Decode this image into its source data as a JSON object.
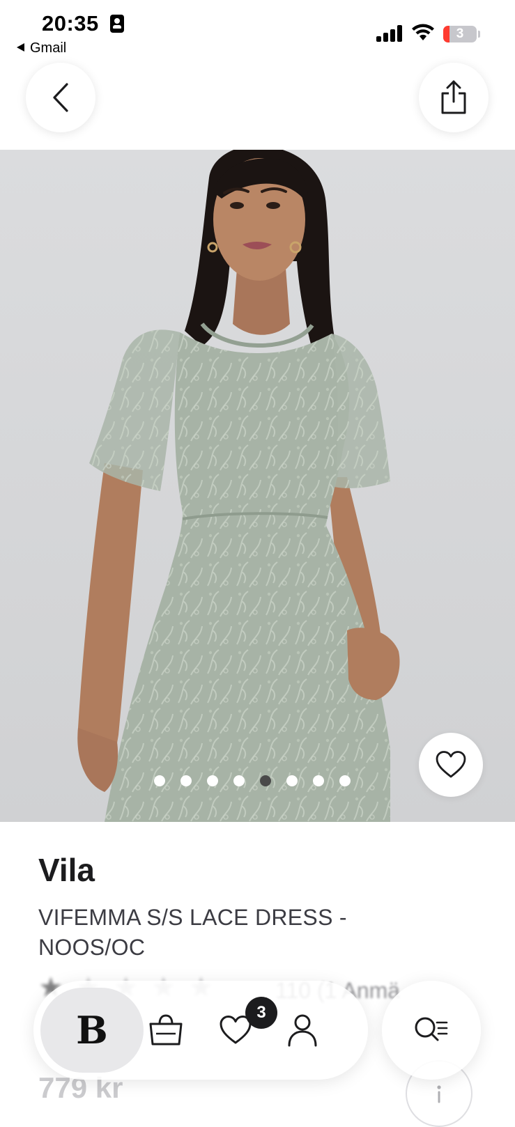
{
  "status_bar": {
    "time": "20:35",
    "back_app_label": "Gmail",
    "battery_level": "3"
  },
  "nav": {
    "back_icon": "chevron-left-icon",
    "share_icon": "share-icon"
  },
  "gallery": {
    "image_count": 8,
    "active_index": 4,
    "wishlist_icon": "heart-outline-icon"
  },
  "product": {
    "brand": "Vila",
    "name": "VIFEMMA S/S LACE DRESS - NOOS/OC",
    "rating_stars_filled": 1,
    "rating_stars_total": 5,
    "rating_text": "110 (1 Anmä",
    "price": "779 kr"
  },
  "tab_bar": {
    "home_logo": "B",
    "wishlist_badge": "3",
    "tabs": [
      "home-icon",
      "bag-icon",
      "heart-icon",
      "account-icon"
    ],
    "search_icon": "search-menu-icon"
  },
  "colors": {
    "image_background": "#d5d6d8",
    "dress": "#a7b3a6",
    "dress_dark": "#8f9c8e",
    "skin": "#b98665",
    "hair": "#1b1412",
    "text_primary": "#1c1c1e",
    "text_secondary": "#3c3c43"
  }
}
